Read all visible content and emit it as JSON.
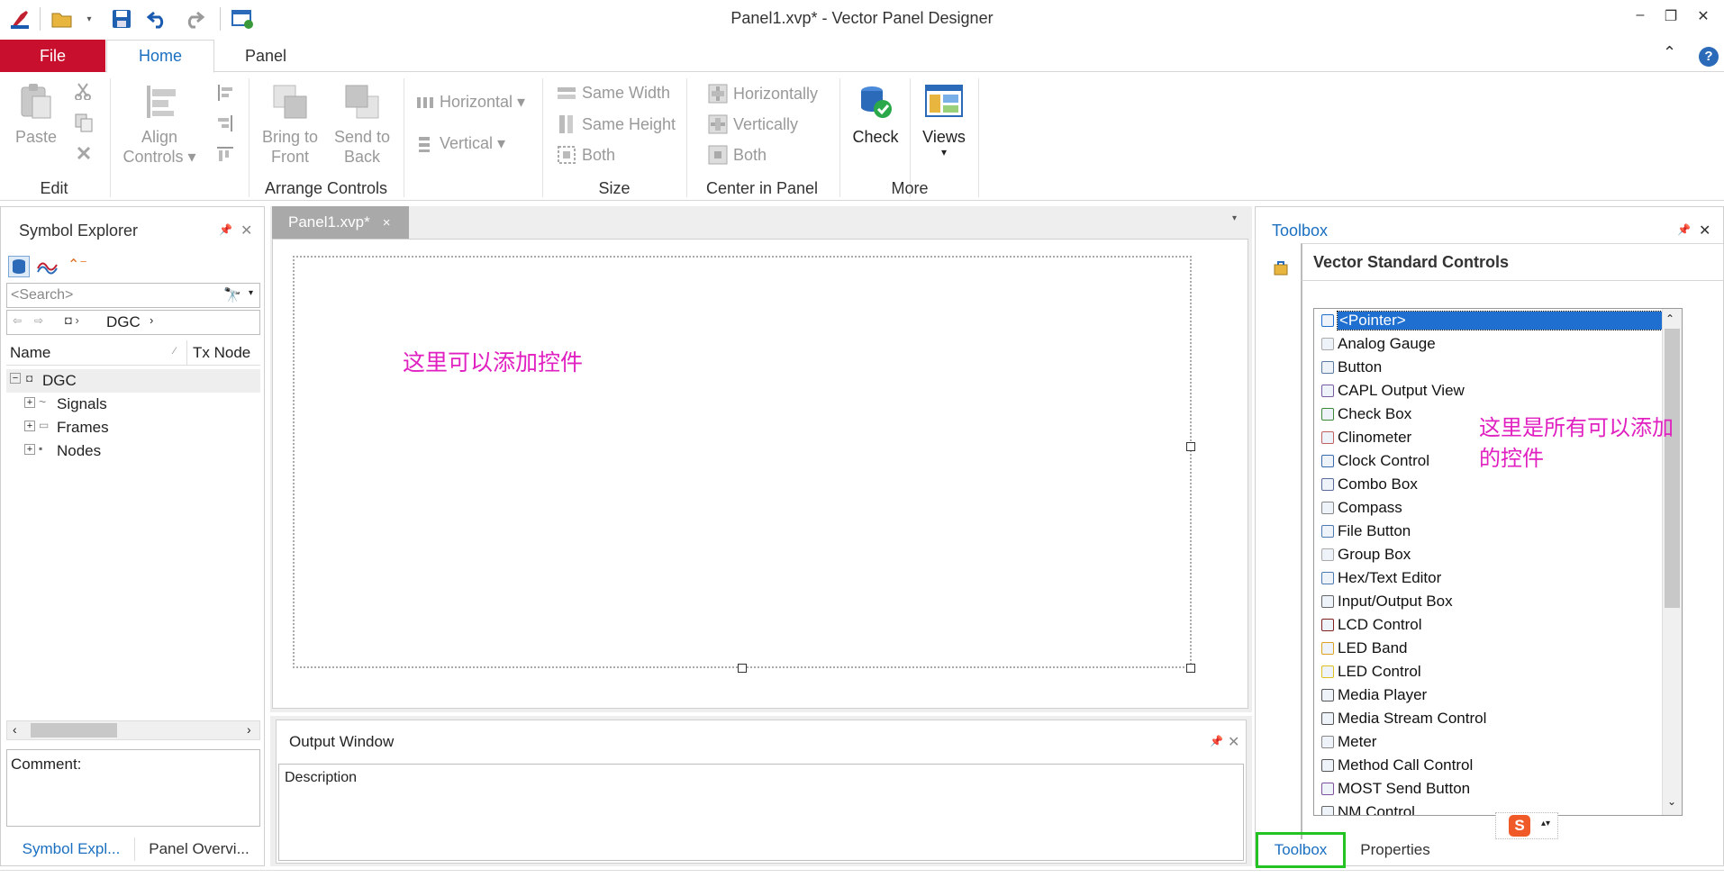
{
  "window": {
    "title": "Panel1.xvp* - Vector Panel Designer",
    "minimize": "–",
    "restore": "❐",
    "close": "✕"
  },
  "ribbon_tabs": {
    "file": "File",
    "home": "Home",
    "panel": "Panel"
  },
  "ribbon": {
    "edit": {
      "label": "Edit",
      "paste": "Paste"
    },
    "arrange": {
      "label": "Arrange Controls",
      "align_controls_1": "Align",
      "align_controls_2": "Controls ▾",
      "bring_to_front_1": "Bring to",
      "bring_to_front_2": "Front",
      "send_to_back_1": "Send to",
      "send_to_back_2": "Back",
      "horizontal": "Horizontal ▾",
      "vertical": "Vertical ▾"
    },
    "size": {
      "label": "Size",
      "same_width": "Same Width",
      "same_height": "Same Height",
      "both": "Both"
    },
    "center": {
      "label": "Center in Panel",
      "horizontally": "Horizontally",
      "vertically": "Vertically",
      "both": "Both"
    },
    "more": {
      "label": "More",
      "check": "Check",
      "views": "Views",
      "views_caret": "▾"
    }
  },
  "symbol_explorer": {
    "title": "Symbol Explorer",
    "search_placeholder": "<Search>",
    "breadcrumb": "DGC",
    "col_name": "Name",
    "col_tx": "Tx Node",
    "tree": {
      "root": "DGC",
      "children": [
        "Signals",
        "Frames",
        "Nodes"
      ]
    },
    "comment_label": "Comment:",
    "tab1": "Symbol Expl...",
    "tab2": "Panel Overvi..."
  },
  "document": {
    "tab": "Panel1.xvp*",
    "tab_close": "×",
    "annotation": "这里可以添加控件"
  },
  "output_window": {
    "title": "Output Window",
    "col_description": "Description"
  },
  "toolbox": {
    "title": "Toolbox",
    "group": "Vector Standard Controls",
    "items": [
      "<Pointer>",
      "Analog Gauge",
      "Button",
      "CAPL Output View",
      "Check Box",
      "Clinometer",
      "Clock Control",
      "Combo Box",
      "Compass",
      "File Button",
      "Group Box",
      "Hex/Text Editor",
      "Input/Output Box",
      "LCD Control",
      "LED Band",
      "LED Control",
      "Media Player",
      "Media Stream Control",
      "Meter",
      "Method Call Control",
      "MOST Send Button",
      "NM Control"
    ],
    "annotation_line1": "这里是所有可以添加",
    "annotation_line2": "的控件",
    "tab_toolbox": "Toolbox",
    "tab_properties": "Properties",
    "highlight_color": "#22c322"
  }
}
